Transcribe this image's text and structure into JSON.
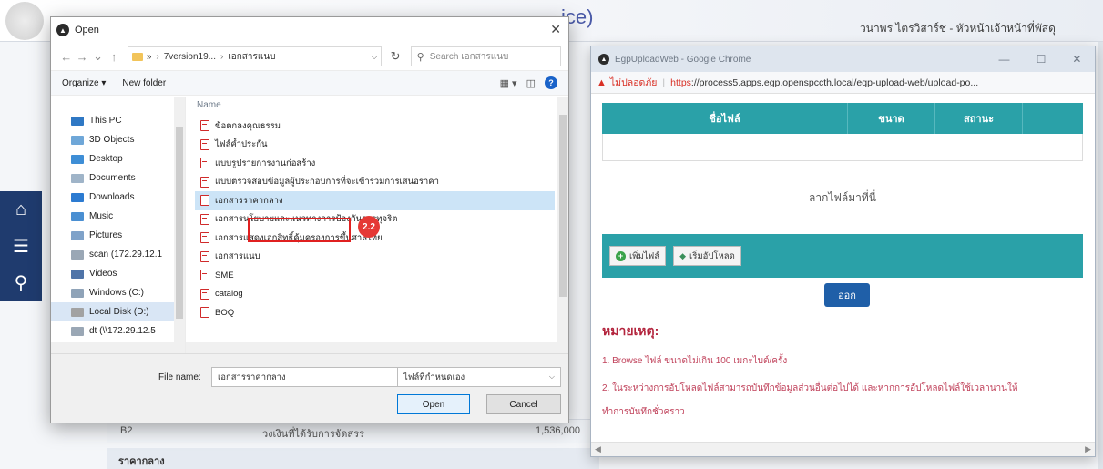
{
  "background": {
    "title_tail": "ice)",
    "user_name": "วนาพร ไตรวิสาร์ช - หัวหน้าเจ้าหน้าที่พัสดุ",
    "table_row": {
      "code": "B2",
      "description": "วงเงินที่ได้รับการจัดสรร",
      "amount": "1,536,000"
    },
    "section_label": "ราคากลาง",
    "sidebar_icons": [
      "home-icon",
      "menu-icon",
      "search-icon"
    ],
    "header_bg": "#1f3b6e"
  },
  "dialog": {
    "title": "Open",
    "path_segments": [
      "7version19...",
      "เอกสารแนบ"
    ],
    "search_placeholder": "Search เอกสารแนบ",
    "toolbar": {
      "organize": "Organize ▾",
      "new_folder": "New folder"
    },
    "nav_items": [
      {
        "label": "This PC",
        "icon": "pc-icon",
        "color": "#2f78c4"
      },
      {
        "label": "3D Objects",
        "icon": "cube-icon",
        "color": "#6fa7d8"
      },
      {
        "label": "Desktop",
        "icon": "desktop-icon",
        "color": "#3e8ed6"
      },
      {
        "label": "Documents",
        "icon": "documents-icon",
        "color": "#9fb4c8"
      },
      {
        "label": "Downloads",
        "icon": "download-icon",
        "color": "#2c7bd1"
      },
      {
        "label": "Music",
        "icon": "music-icon",
        "color": "#4a8fd2"
      },
      {
        "label": "Pictures",
        "icon": "pictures-icon",
        "color": "#7fa2c9"
      },
      {
        "label": "scan (172.29.12.1",
        "icon": "network-drive-icon",
        "color": "#9aa7b5"
      },
      {
        "label": "Videos",
        "icon": "videos-icon",
        "color": "#4f74a8"
      },
      {
        "label": "Windows (C:)",
        "icon": "drive-icon",
        "color": "#8fa3b8"
      },
      {
        "label": "Local Disk (D:)",
        "icon": "drive-icon",
        "color": "#a2a2a2"
      },
      {
        "label": "dt (\\\\172.29.12.5",
        "icon": "network-drive-icon",
        "color": "#9aa7b5"
      }
    ],
    "column_name": "Name",
    "files": [
      "ข้อตกลงคุณธรรม",
      "ไฟล์ค้ำประกัน",
      "แบบรูปรายการงานก่อสร้าง",
      "แบบตรวจสอบข้อมูลผู้ประกอบการที่จะเข้าร่วมการเสนอราคา",
      "เอกสารราคากลาง",
      "เอกสารนโยบายและแนวทางการป้องกันการทุจริต",
      "เอกสารแสดงเอกสิทธิ์คุ้มครองการขึ้นศาลไทย",
      "เอกสารแนบ",
      "SME",
      "catalog",
      "BOQ"
    ],
    "selected_file_index": 4,
    "step_badge": "2.2",
    "file_name_label": "File name:",
    "file_name_value": "เอกสารราคากลาง",
    "file_type": "ไฟล์ที่กำหนดเอง",
    "open_label": "Open",
    "cancel_label": "Cancel"
  },
  "chrome": {
    "title": "EgpUploadWeb - Google Chrome",
    "not_secure": "ไม่ปลอดภัย",
    "url_scheme": "https",
    "url_rest": "://process5.apps.egp.openspccth.local/egp-upload-web/upload-po...",
    "table_headers": [
      "ชื่อไฟล์",
      "ขนาด",
      "สถานะ"
    ],
    "drop_text": "ลากไฟล์มาที่นี่",
    "add_file": "เพิ่มไฟล์",
    "start_upload": "เริ่มอัปโหลด",
    "exit_label": "ออก",
    "note_title": "หมายเหตุ:",
    "notes": [
      "1. Browse ไฟล์ ขนาดไม่เกิน 100 เมกะไบต์/ครั้ง",
      "2. ในระหว่างการอัปโหลดไฟล์สามารถบันทึกข้อมูลส่วนอื่นต่อไปได้ และหากการอัปโหลดไฟล์ใช้เวลานานให้",
      "ทำการบันทึกชั่วคราว"
    ],
    "accent": "#2aa1a8"
  }
}
